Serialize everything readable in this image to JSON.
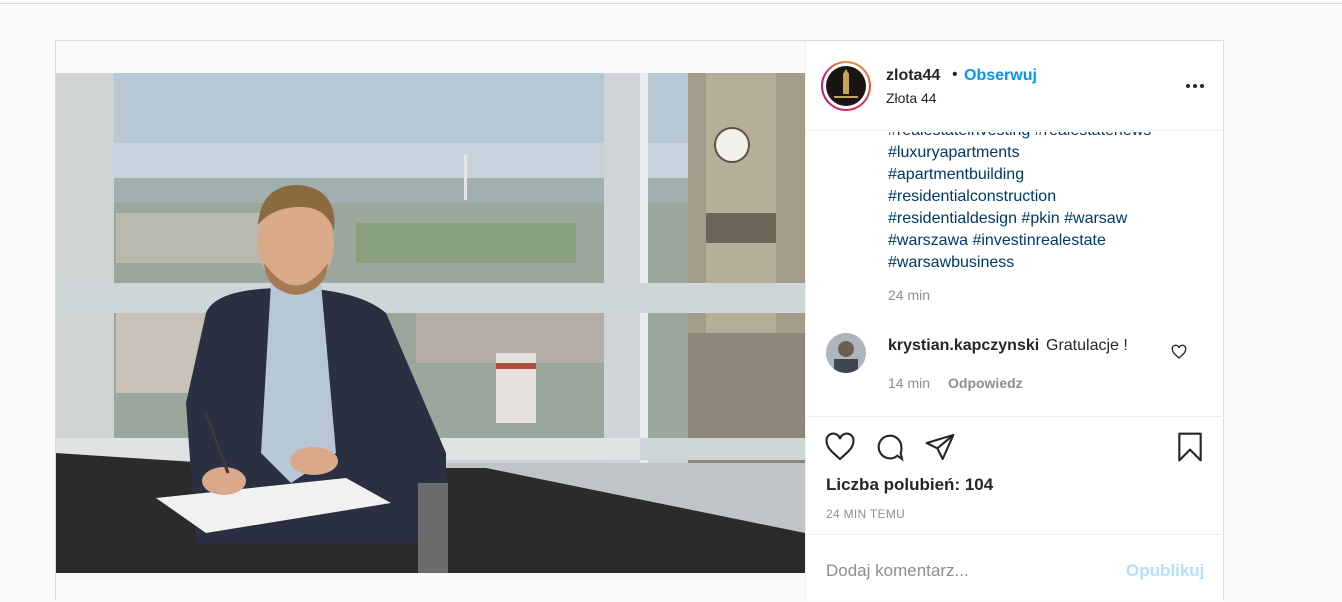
{
  "post": {
    "username": "zlota44",
    "separator": "•",
    "follow_label": "Obserwuj",
    "location": "Złota 44",
    "more_icon": "more-horizontal-icon",
    "caption": {
      "hashtags_lines": [
        "#realestateinvesting #realestatenews",
        "#luxuryapartments",
        "#apartmentbuilding",
        "#residentialconstruction",
        "#residentialdesign #pkin #warsaw",
        "#warszawa #investinrealestate",
        "#warsawbusiness"
      ],
      "time": "24 min"
    },
    "comment": {
      "username": "krystian.kapczynski",
      "text": "Gratulacje !",
      "time": "14 min",
      "reply_label": "Odpowiedz"
    },
    "likes_text": "Liczba polubień: 104",
    "posted_ago": "24 MIN TEMU",
    "add_comment": {
      "placeholder": "Dodaj komentarz...",
      "publish_label": "Opublikuj"
    }
  },
  "colors": {
    "link": "#00376b",
    "follow": "#0095f6",
    "publish_disabled": "#b2dffc",
    "muted": "#8e8e8e",
    "border": "#dbdbdb"
  }
}
